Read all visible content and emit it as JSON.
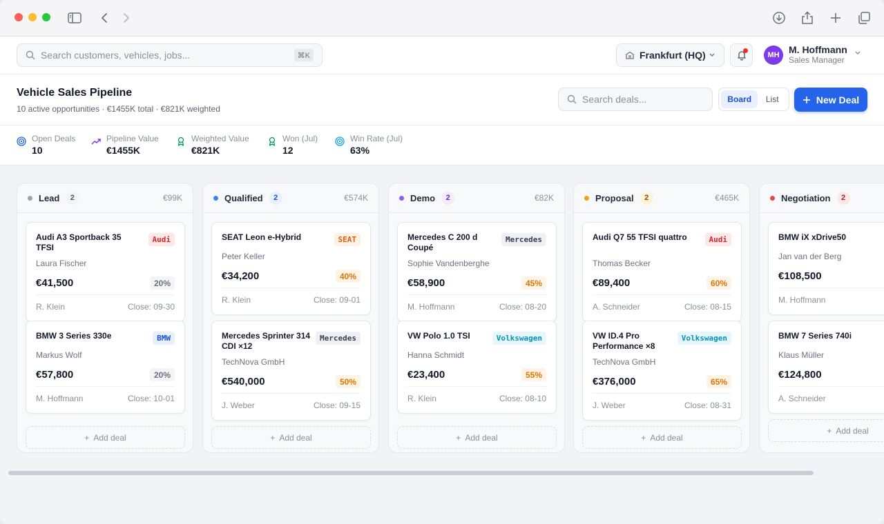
{
  "top": {
    "search_placeholder": "Search customers, vehicles, jobs...",
    "search_shortcut": "⌘K",
    "location": "Frankfurt (HQ)",
    "user_initials": "MH",
    "user_name": "M. Hoffmann",
    "user_role": "Sales Manager"
  },
  "page": {
    "title": "Vehicle Sales Pipeline",
    "subtitle": "10 active opportunities · €1455K total · €821K weighted",
    "deal_search_placeholder": "Search deals...",
    "view_board": "Board",
    "view_list": "List",
    "new_deal": "New Deal"
  },
  "stats": [
    {
      "label": "Open Deals",
      "value": "10",
      "icon": "target-icon",
      "color": "#2563eb"
    },
    {
      "label": "Pipeline Value",
      "value": "€1455K",
      "icon": "trending-up-icon",
      "color": "#7c3aed"
    },
    {
      "label": "Weighted Value",
      "value": "€821K",
      "icon": "award-icon",
      "color": "#059669"
    },
    {
      "label": "Won (Jul)",
      "value": "12",
      "icon": "award-icon",
      "color": "#059669"
    },
    {
      "label": "Win Rate (Jul)",
      "value": "63%",
      "icon": "target-icon",
      "color": "#0ea5e9"
    }
  ],
  "add_deal_label": "Add deal",
  "columns": [
    {
      "name": "Lead",
      "count": "2",
      "total": "€99K",
      "dot": "#9ca3af",
      "badge_bg": "#f3f4f6",
      "badge_fg": "#4b5563",
      "cards": [
        {
          "title": "Audi A3 Sportback 35 TFSI",
          "brand": "Audi",
          "customer": "Laura Fischer",
          "amount": "€41,500",
          "prob": "20%",
          "owner": "R. Klein",
          "close": "Close: 09-30"
        },
        {
          "title": "BMW 3 Series 330e",
          "brand": "BMW",
          "customer": "Markus Wolf",
          "amount": "€57,800",
          "prob": "20%",
          "owner": "M. Hoffmann",
          "close": "Close: 10-01"
        }
      ]
    },
    {
      "name": "Qualified",
      "count": "2",
      "total": "€574K",
      "dot": "#3b82f6",
      "badge_bg": "#e8f0fe",
      "badge_fg": "#1d4ed8",
      "cards": [
        {
          "title": "SEAT Leon e-Hybrid",
          "brand": "SEAT",
          "customer": "Peter Keller",
          "amount": "€34,200",
          "prob": "40%",
          "owner": "R. Klein",
          "close": "Close: 09-01"
        },
        {
          "title": "Mercedes Sprinter 314 CDI ×12",
          "brand": "Mercedes",
          "customer": "TechNova GmbH",
          "amount": "€540,000",
          "prob": "50%",
          "owner": "J. Weber",
          "close": "Close: 09-15"
        }
      ]
    },
    {
      "name": "Demo",
      "count": "2",
      "total": "€82K",
      "dot": "#8b5cf6",
      "badge_bg": "#f1ebfe",
      "badge_fg": "#6d28d9",
      "cards": [
        {
          "title": "Mercedes C 200 d Coupé",
          "brand": "Mercedes",
          "customer": "Sophie Vandenberghe",
          "amount": "€58,900",
          "prob": "45%",
          "owner": "M. Hoffmann",
          "close": "Close: 08-20"
        },
        {
          "title": "VW Polo 1.0 TSI",
          "brand": "Volkswagen",
          "customer": "Hanna Schmidt",
          "amount": "€23,400",
          "prob": "55%",
          "owner": "R. Klein",
          "close": "Close: 08-10"
        }
      ]
    },
    {
      "name": "Proposal",
      "count": "2",
      "total": "€465K",
      "dot": "#f59e0b",
      "badge_bg": "#fdf3d7",
      "badge_fg": "#92400e",
      "cards": [
        {
          "title": "Audi Q7 55 TFSI quattro",
          "brand": "Audi",
          "customer": "Thomas Becker",
          "amount": "€89,400",
          "prob": "60%",
          "owner": "A. Schneider",
          "close": "Close: 08-15"
        },
        {
          "title": "VW ID.4 Pro Performance ×8",
          "brand": "Volkswagen",
          "customer": "TechNova GmbH",
          "amount": "€376,000",
          "prob": "65%",
          "owner": "J. Weber",
          "close": "Close: 08-31"
        }
      ]
    },
    {
      "name": "Negotiation",
      "count": "2",
      "total": "",
      "dot": "#ef4444",
      "badge_bg": "#fde8e8",
      "badge_fg": "#b91c1c",
      "cards": [
        {
          "title": "BMW iX xDrive50",
          "brand": "",
          "customer": "Jan van der Berg",
          "amount": "€108,500",
          "prob": "",
          "owner": "M. Hoffmann",
          "close": "Clos"
        },
        {
          "title": "BMW 7 Series 740i",
          "brand": "",
          "customer": "Klaus Müller",
          "amount": "€124,800",
          "prob": "",
          "owner": "A. Schneider",
          "close": "Clos"
        }
      ]
    }
  ],
  "brand_colors": {
    "Audi": {
      "bg": "#fde8e8",
      "fg": "#dc2626"
    },
    "BMW": {
      "bg": "#e8f0fe",
      "fg": "#1d4ed8"
    },
    "SEAT": {
      "bg": "#fef1e4",
      "fg": "#ea580c"
    },
    "Mercedes": {
      "bg": "#eef0f3",
      "fg": "#374151"
    },
    "Volkswagen": {
      "bg": "#e6f6fd",
      "fg": "#0891b2"
    }
  },
  "prob_colors": {
    "20%": {
      "bg": "#f3f4f6",
      "fg": "#6b7280"
    },
    "40%": {
      "bg": "#fef4e6",
      "fg": "#d97706"
    },
    "45%": {
      "bg": "#fef4e6",
      "fg": "#d97706"
    },
    "50%": {
      "bg": "#fef4e6",
      "fg": "#d97706"
    },
    "55%": {
      "bg": "#fef4e6",
      "fg": "#d97706"
    },
    "60%": {
      "bg": "#fef4e6",
      "fg": "#d97706"
    },
    "65%": {
      "bg": "#fef4e6",
      "fg": "#d97706"
    }
  }
}
